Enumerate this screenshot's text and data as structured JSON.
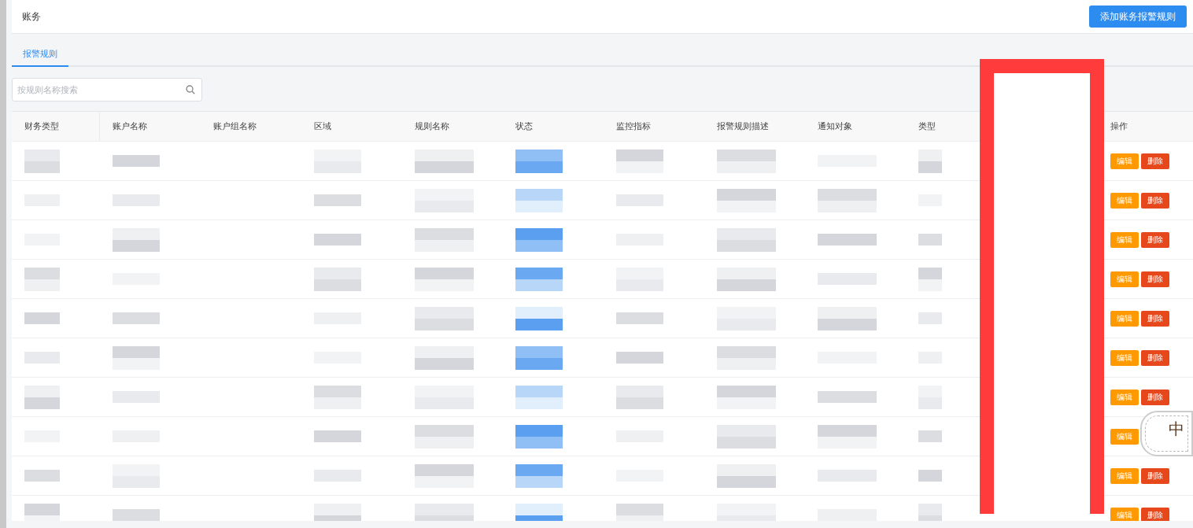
{
  "header": {
    "title": "账务",
    "add_button": "添加账务报警规则"
  },
  "tabs": [
    {
      "label": "报警规则",
      "selected": true
    }
  ],
  "search": {
    "placeholder": "按规则名称搜索"
  },
  "table": {
    "columns": [
      "财务类型",
      "账户名称",
      "账户组名称",
      "区域",
      "规则名称",
      "状态",
      "监控指标",
      "报警规则描述",
      "通知对象",
      "类型",
      "操作"
    ],
    "rows": [
      {
        "actions": [
          "编辑",
          "删除"
        ]
      },
      {
        "actions": [
          "编辑",
          "删除"
        ]
      },
      {
        "actions": [
          "编辑",
          "删除"
        ]
      },
      {
        "actions": [
          "编辑",
          "删除"
        ]
      },
      {
        "actions": [
          "编辑",
          "删除"
        ]
      },
      {
        "actions": [
          "编辑",
          "删除"
        ]
      },
      {
        "actions": [
          "编辑",
          "删除"
        ]
      },
      {
        "actions": [
          "编辑"
        ]
      },
      {
        "actions": [
          "编辑",
          "删除"
        ]
      },
      {
        "actions": [
          "编辑",
          "删除"
        ]
      }
    ]
  },
  "ime_badge": {
    "label": "中"
  }
}
